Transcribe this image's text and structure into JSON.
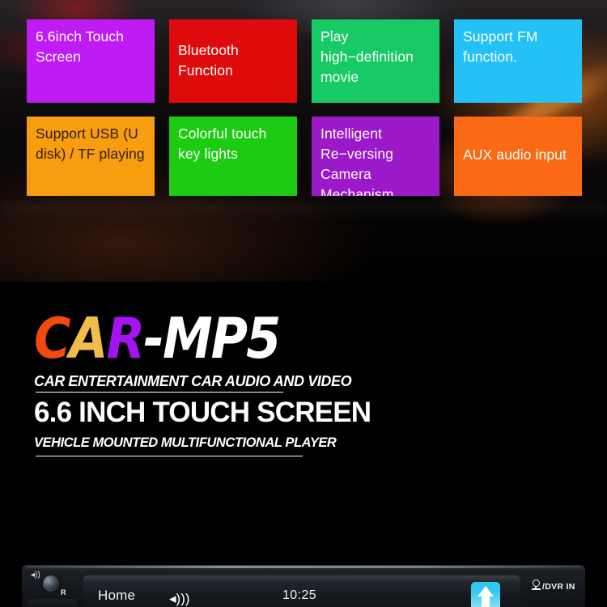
{
  "features": {
    "rows": [
      [
        {
          "label": "6.6inch Touch Screen",
          "color": "#bf1bf5",
          "text_color": "#ffffff"
        },
        {
          "label": "Bluetooth Function",
          "color": "#dd0b0b",
          "text_color": "#ffffff"
        },
        {
          "label": "Play high−definition movie",
          "color": "#17ca66",
          "text_color": "#ffffff"
        },
        {
          "label": "Support FM function.",
          "color": "#23c1f5",
          "text_color": "#ffffff"
        }
      ],
      [
        {
          "label": "Support USB (U disk) /  TF  playing",
          "color": "#f89c10",
          "text_color": "#2b2215"
        },
        {
          "label": "Colorful touch key lights",
          "color": "#1ccb12",
          "text_color": "#ffffff"
        },
        {
          "label": "Intelligent Re−versing Camera Mechanism",
          "color": "#9b19c8",
          "text_color": "#ffffff"
        },
        {
          "label": "AUX audio input",
          "color": "#fa6a14",
          "text_color": "#ffffff"
        }
      ]
    ]
  },
  "branding": {
    "logo": {
      "part_c": "C",
      "part_a": "A",
      "part_r": "R",
      "part_rest": "-MP5",
      "color_c": "#f2490f",
      "color_a": "#f0bc4a",
      "color_r": "#a413f0",
      "color_rest": "#ffffff"
    },
    "tagline_top": "CAR ENTERTAINMENT CAR AUDIO AND VIDEO",
    "headline": "6.6 INCH TOUCH SCREEN",
    "tagline_bottom": "VEHICLE MOUNTED MULTIFUNCTIONAL PLAYER"
  },
  "device": {
    "home_label": "Home",
    "volume_icon": "◂)))",
    "clock": "10:25",
    "up_button_icon": "up-arrow-icon",
    "r_label": "R",
    "left_speaker_icon": "◂))",
    "dvr_label": "/DVR IN"
  }
}
